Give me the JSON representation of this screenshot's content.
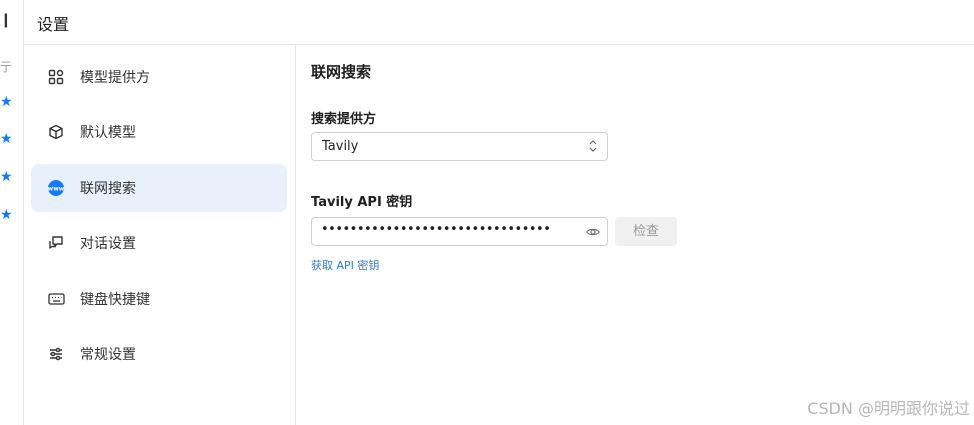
{
  "window": {
    "title": "设置"
  },
  "left_edge": {
    "glyph_top": "❙",
    "glyph_mid": "亍"
  },
  "sidebar": {
    "items": [
      {
        "label": "模型提供方",
        "icon": "grid-icon",
        "active": false
      },
      {
        "label": "默认模型",
        "icon": "cube-icon",
        "active": false
      },
      {
        "label": "联网搜索",
        "icon": "globe-www-icon",
        "active": true
      },
      {
        "label": "对话设置",
        "icon": "chat-settings-icon",
        "active": false
      },
      {
        "label": "键盘快捷键",
        "icon": "keyboard-icon",
        "active": false
      },
      {
        "label": "常规设置",
        "icon": "sliders-icon",
        "active": false
      }
    ]
  },
  "main": {
    "section_title": "联网搜索",
    "provider": {
      "label": "搜索提供方",
      "value": "Tavily"
    },
    "api_key": {
      "label": "Tavily API 密钥",
      "masked_value": "••••••••••••••••••••••••••••••••••••••••",
      "check_button": "检查",
      "get_key_link": "获取 API 密钥"
    }
  },
  "watermark": "CSDN @明明跟你说过",
  "colors": {
    "accent": "#1677ff",
    "active_bg": "#e8f1fb",
    "link": "#2f7fbf",
    "border": "#e6e6e6"
  }
}
